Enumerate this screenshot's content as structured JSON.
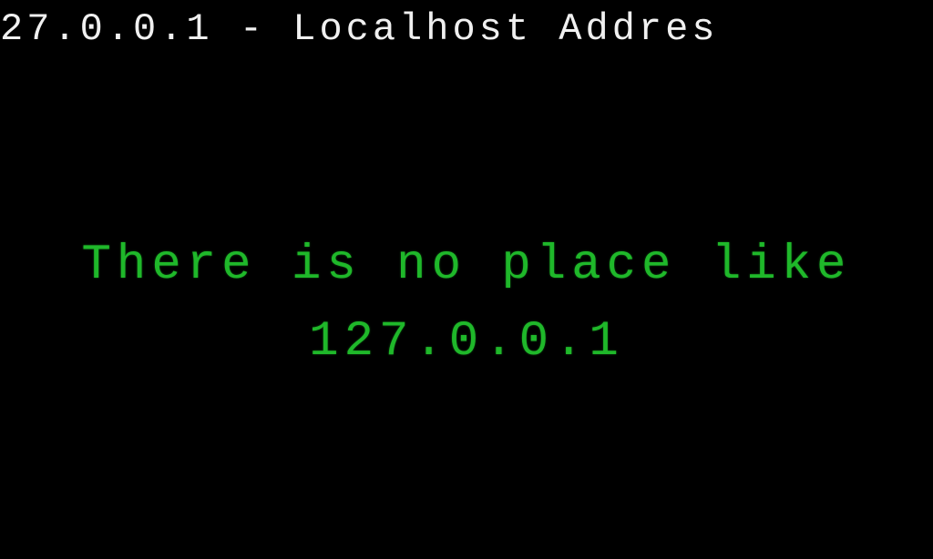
{
  "header": {
    "title": "27.0.0.1 - Localhost Addres"
  },
  "main": {
    "slogan_line1": "There is no place like",
    "slogan_line2": "127.0.0.1"
  },
  "colors": {
    "background": "#000000",
    "header_text": "#f0f0f0",
    "slogan_text": "#1fb82a"
  }
}
